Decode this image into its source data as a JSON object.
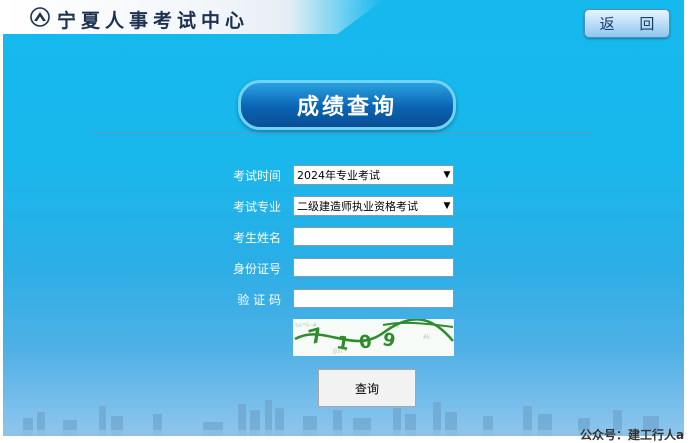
{
  "header": {
    "site_name": "宁夏人事考试中心",
    "back_label": "返 回"
  },
  "page_title": "成绩查询",
  "form": {
    "exam_time": {
      "label": "考试时间",
      "value": "2024年专业考试"
    },
    "exam_major": {
      "label": "考试专业",
      "value": "二级建造师执业资格考试"
    },
    "name": {
      "label": "考生姓名",
      "value": ""
    },
    "id_number": {
      "label": "身份证号",
      "value": ""
    },
    "captcha": {
      "label": "验 证 码",
      "value": "",
      "image_text": "7109"
    },
    "submit_label": "查询"
  },
  "watermark": "公众号：建工行人a",
  "colors": {
    "background": "#16b9ee",
    "title_pill": "#0a63b2",
    "captcha_ink": "#2e8b2e"
  }
}
